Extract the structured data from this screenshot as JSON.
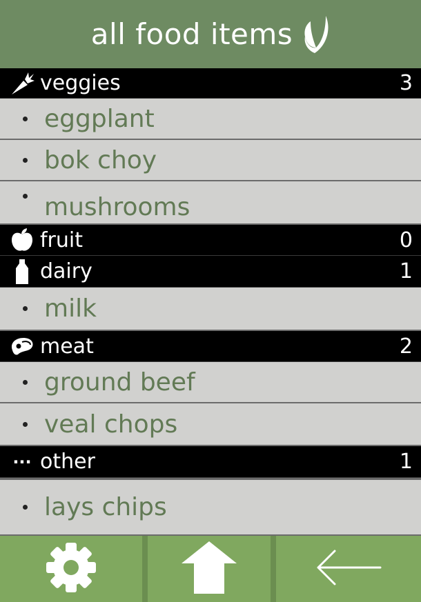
{
  "header": {
    "title": "all food items",
    "icon": "leaf-icon"
  },
  "categories": [
    {
      "label": "veggies",
      "count": "3",
      "icon": "carrot-icon",
      "items": [
        "eggplant",
        "bok choy",
        "mushrooms"
      ]
    },
    {
      "label": "fruit",
      "count": "0",
      "icon": "apple-icon",
      "items": []
    },
    {
      "label": "dairy",
      "count": "1",
      "icon": "bottle-icon",
      "items": [
        "milk"
      ]
    },
    {
      "label": "meat",
      "count": "2",
      "icon": "steak-icon",
      "items": [
        "ground beef",
        "veal chops"
      ]
    },
    {
      "label": "other",
      "count": "1",
      "icon": "ellipsis-icon",
      "items": [
        "lays chips"
      ]
    }
  ],
  "ellipsis_glyph": "···",
  "nav": {
    "settings_icon": "gear-icon",
    "home_icon": "home-icon",
    "back_icon": "back-arrow-icon"
  },
  "colors": {
    "header": "#6e8b62",
    "category_bar": "#000000",
    "item_bg": "#d1d1cf",
    "item_text": "#627a55",
    "nav_bar": "#80a85f"
  }
}
